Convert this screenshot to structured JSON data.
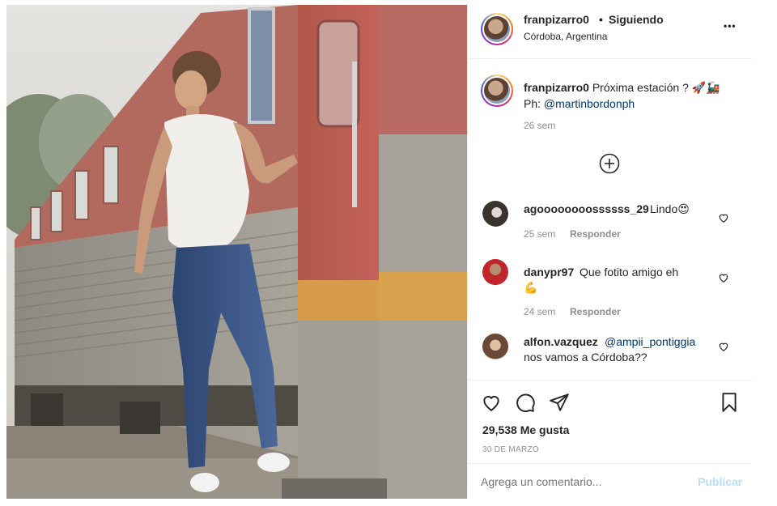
{
  "header": {
    "username": "franpizarro0",
    "dot": "•",
    "following_label": "Siguiendo",
    "location": "Córdoba, Argentina",
    "more_label": "•••"
  },
  "caption": {
    "username": "franpizarro0",
    "text": "Próxima estación ? 🚀🚂",
    "line2_prefix": "Ph:",
    "mention": "@martinbordonph",
    "time": "26 sem"
  },
  "load_more_icon": "plus-circle-icon",
  "comments": [
    {
      "username": "agoooooooossssss_29",
      "text": "Lindo😍",
      "time": "25 sem",
      "reply": "Responder"
    },
    {
      "username": "danypr97",
      "text": "Que fotito amigo eh",
      "text2": "💪",
      "time": "24 sem",
      "reply": "Responder"
    },
    {
      "username": "alfon.vazquez",
      "mention": "@ampii_pontiggia",
      "text2": "nos vamos a Córdoba??"
    }
  ],
  "stats": {
    "likes": "29,538 Me gusta",
    "date": "30 DE MARZO"
  },
  "add_comment": {
    "placeholder": "Agrega un comentario...",
    "publish_label": "Publicar"
  },
  "colors": {
    "accent": "#0095f6",
    "publish_disabled": "#b2dffc",
    "text": "#262626",
    "muted": "#8e8e8e",
    "link": "#00376b"
  }
}
